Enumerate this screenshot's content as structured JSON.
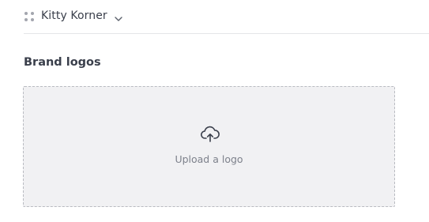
{
  "header": {
    "workspace_name": "Kitty Korner",
    "workspace_icon": "grid-dots-icon",
    "dropdown_icon": "chevron-down-icon"
  },
  "section": {
    "title": "Brand logos"
  },
  "dropzone": {
    "icon": "cloud-upload-icon",
    "label": "Upload a logo"
  },
  "colors": {
    "text": "#3a3f4b",
    "muted_text": "#7d818b",
    "dropzone_bg": "#f1f1f3",
    "dropzone_border": "#b9bbc1",
    "divider": "#e4e5e8"
  }
}
